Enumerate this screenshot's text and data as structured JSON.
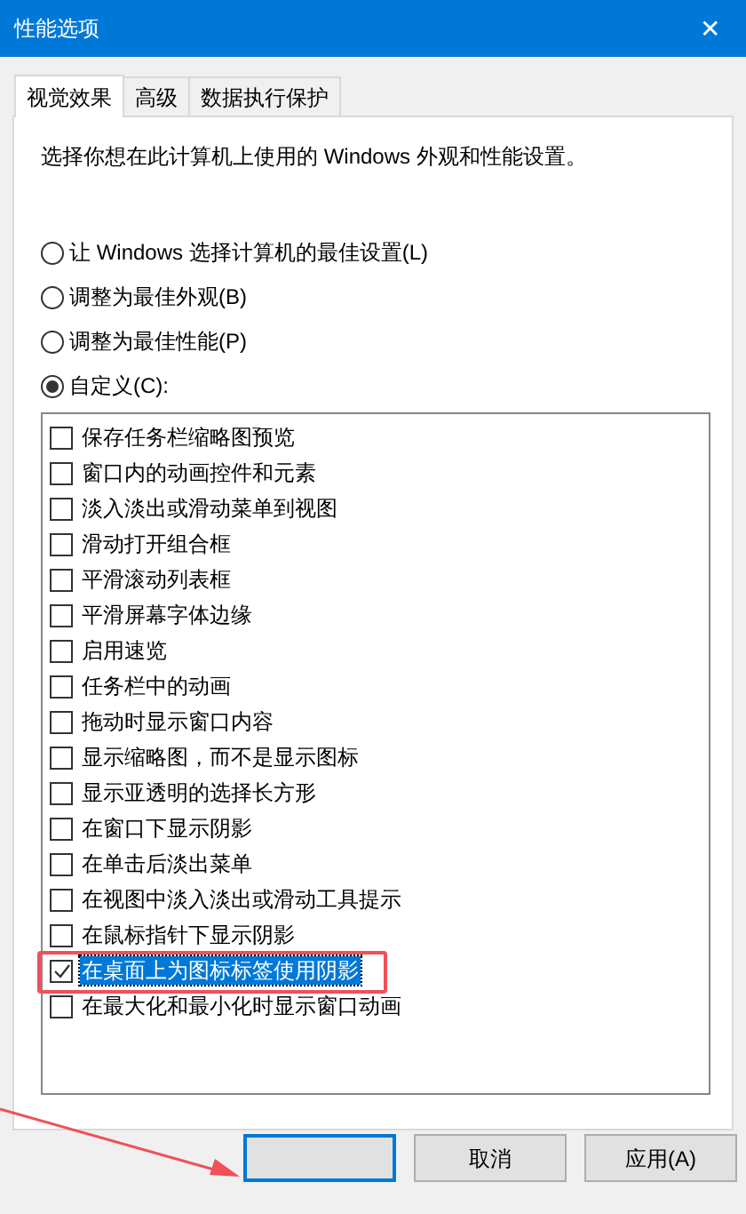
{
  "window": {
    "title": "性能选项",
    "close": "✕"
  },
  "tabs": [
    {
      "label": "视觉效果",
      "selected": true
    },
    {
      "label": "高级",
      "selected": false
    },
    {
      "label": "数据执行保护",
      "selected": false
    }
  ],
  "description": "选择你想在此计算机上使用的 Windows 外观和性能设置。",
  "options": [
    {
      "label": "让 Windows 选择计算机的最佳设置(L)",
      "selected": false
    },
    {
      "label": "调整为最佳外观(B)",
      "selected": false
    },
    {
      "label": "调整为最佳性能(P)",
      "selected": false
    },
    {
      "label": "自定义(C):",
      "selected": true
    }
  ],
  "effects": [
    {
      "label": "保存任务栏缩略图预览",
      "checked": false,
      "selected": false
    },
    {
      "label": "窗口内的动画控件和元素",
      "checked": false,
      "selected": false
    },
    {
      "label": "淡入淡出或滑动菜单到视图",
      "checked": false,
      "selected": false
    },
    {
      "label": "滑动打开组合框",
      "checked": false,
      "selected": false
    },
    {
      "label": "平滑滚动列表框",
      "checked": false,
      "selected": false
    },
    {
      "label": "平滑屏幕字体边缘",
      "checked": false,
      "selected": false
    },
    {
      "label": "启用速览",
      "checked": false,
      "selected": false
    },
    {
      "label": "任务栏中的动画",
      "checked": false,
      "selected": false
    },
    {
      "label": "拖动时显示窗口内容",
      "checked": false,
      "selected": false
    },
    {
      "label": "显示缩略图，而不是显示图标",
      "checked": false,
      "selected": false
    },
    {
      "label": "显示亚透明的选择长方形",
      "checked": false,
      "selected": false
    },
    {
      "label": "在窗口下显示阴影",
      "checked": false,
      "selected": false
    },
    {
      "label": "在单击后淡出菜单",
      "checked": false,
      "selected": false
    },
    {
      "label": "在视图中淡入淡出或滑动工具提示",
      "checked": false,
      "selected": false
    },
    {
      "label": "在鼠标指针下显示阴影",
      "checked": false,
      "selected": false
    },
    {
      "label": "在桌面上为图标标签使用阴影",
      "checked": true,
      "selected": true
    },
    {
      "label": "在最大化和最小化时显示窗口动画",
      "checked": false,
      "selected": false
    }
  ],
  "buttons": [
    {
      "default": true
    },
    {
      "label": "取消",
      "default": false
    },
    {
      "label": "应用(A)",
      "default": false
    }
  ]
}
